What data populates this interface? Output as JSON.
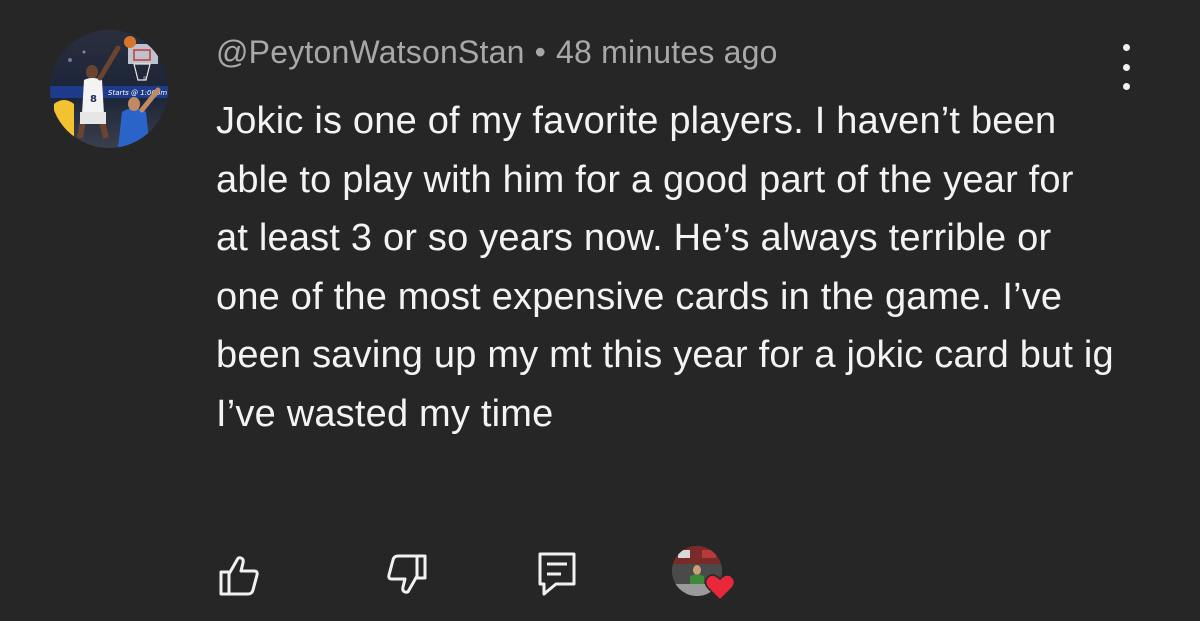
{
  "comment": {
    "author": "@PeytonWatsonStan",
    "separator": "•",
    "timestamp": "48 minutes ago",
    "text": "Jokic is one of my favorite players. I haven’t been able to play with him for a good part of the year for at least 3 or so years now. He’s always terrible or one of the most expensive cards in the game. I’ve been saving up my mt this year for a jokic card but ig I’ve wasted my time",
    "avatar_overlay_text": "Starts @ 1:00pm",
    "jersey_number": "8"
  },
  "actions": {
    "like_icon": "thumbs-up-icon",
    "dislike_icon": "thumbs-down-icon",
    "reply_icon": "reply-icon",
    "more_icon": "more-vertical-icon",
    "creator_heart_icon": "heart-icon"
  },
  "colors": {
    "background": "#262626",
    "text_primary": "#f3f3f3",
    "text_secondary": "#a8a8a8",
    "heart": "#e8283a"
  }
}
